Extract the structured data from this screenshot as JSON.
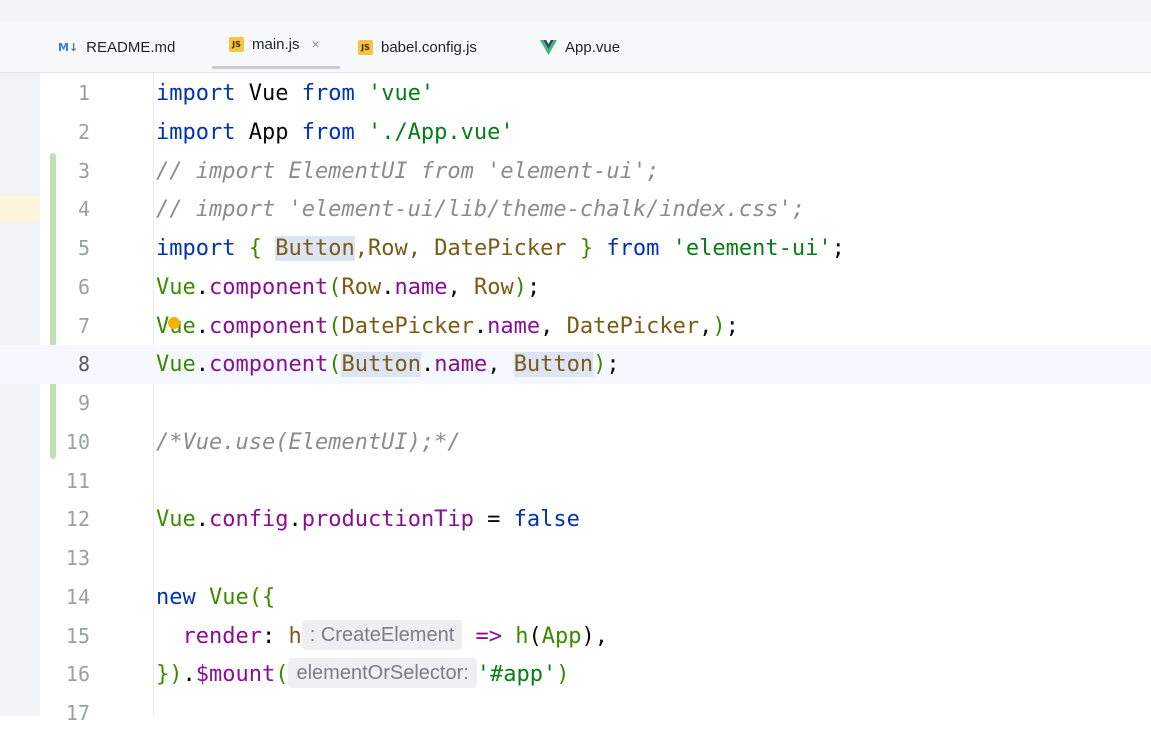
{
  "tabs": [
    {
      "icon": "markdown-icon",
      "icon_text": "M↓",
      "label": "README.md",
      "active": false
    },
    {
      "icon": "js-file-icon",
      "icon_text": "JS",
      "label": "main.js",
      "active": true,
      "close": "×"
    },
    {
      "icon": "js-file-icon",
      "icon_text": "JS",
      "label": "babel.config.js",
      "active": false
    },
    {
      "icon": "vue-file-icon",
      "icon_text": "",
      "label": "App.vue",
      "active": false
    }
  ],
  "line_numbers": [
    "1",
    "2",
    "3",
    "4",
    "5",
    "6",
    "7",
    "8",
    "9",
    "10",
    "11",
    "12",
    "13",
    "14",
    "15",
    "16",
    "17"
  ],
  "code": {
    "l1": {
      "kw1": "import",
      "id": " Vue ",
      "kw2": "from",
      "str": " 'vue'"
    },
    "l2": {
      "kw1": "import",
      "id": " App ",
      "kw2": "from",
      "str": " './App.vue'"
    },
    "l3": "// import ElementUI from 'element-ui';",
    "l4": "// import 'element-ui/lib/theme-chalk/index.css';",
    "l5": {
      "kw1": "import",
      "open": " { ",
      "a": "Button",
      "b": ",Row, ",
      "c": "DatePicker",
      "close": " } ",
      "kw2": "from",
      "str": " 'element-ui'",
      "end": ";"
    },
    "l6": {
      "obj": "Vue",
      "dot": ".",
      "fn": "component",
      "open": "(",
      "a": "Row",
      "dot2": ".",
      "prop": "name",
      "sep": ", ",
      "b": "Row",
      "close": ")",
      "end": ";"
    },
    "l7": {
      "obj": "Vue",
      "dot": ".",
      "fn": "component",
      "open": "(",
      "a": "DatePicker",
      "dot2": ".",
      "prop": "name",
      "sep": ", ",
      "b": "DatePicker",
      "tail": ",",
      "close": ")",
      "end": ";"
    },
    "l8": {
      "obj": "Vue",
      "dot": ".",
      "fn": "component",
      "open": "(",
      "a": "Button",
      "dot2": ".",
      "prop": "name",
      "sep": ", ",
      "b": "Button",
      "close": ")",
      "end": ";"
    },
    "l10": "/*Vue.use(ElementUI);*/",
    "l12": {
      "obj": "Vue",
      "dot": ".",
      "p1": "config",
      "dot2": ".",
      "p2": "productionTip",
      "eq": " = ",
      "lit": "false"
    },
    "l14": {
      "kw": "new",
      "obj": " Vue",
      "open": "({"
    },
    "l15": {
      "indent": "  ",
      "prop": "render",
      "colon": ": ",
      "arg": "h",
      "hint": ": CreateElement",
      "arrow": " => ",
      "fn": "h",
      "open": "(",
      "a": "App",
      "close": ")",
      "end": ","
    },
    "l16": {
      "close": "})",
      "dot": ".",
      "fn": "$mount",
      "open": "(",
      "hint": "elementOrSelector:",
      "str": "'#app'",
      "close2": ")"
    }
  }
}
